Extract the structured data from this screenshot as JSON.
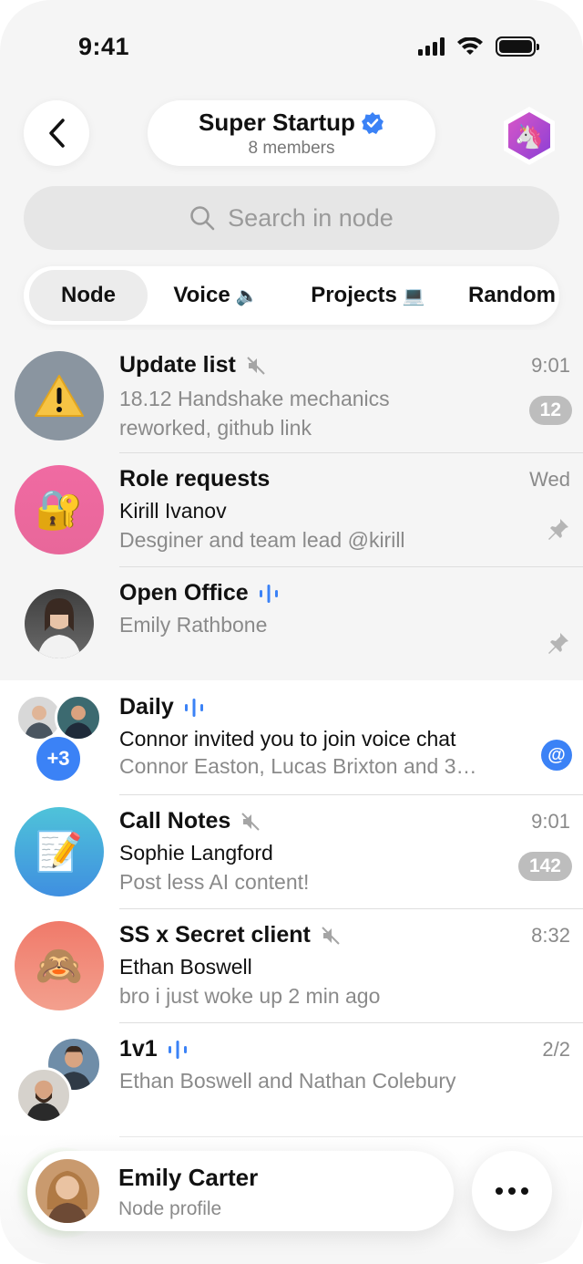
{
  "status_bar": {
    "time": "9:41"
  },
  "header": {
    "title": "Super Startup",
    "subtitle": "8 members",
    "verified_icon": "verified-badge-icon",
    "node_icon": "unicorn-hexagon-icon"
  },
  "search": {
    "placeholder": "Search in node"
  },
  "tabs": [
    {
      "label": "Node",
      "emoji": ""
    },
    {
      "label": "Voice",
      "emoji": "🔈"
    },
    {
      "label": "Projects",
      "emoji": "💻"
    },
    {
      "label": "Random",
      "emoji": ""
    }
  ],
  "chats": [
    {
      "name": "Update list",
      "line2": "18.12  Handshake mechanics",
      "line3": "reworked, github link",
      "time": "9:01",
      "badge": "12",
      "muted": true,
      "avatar_emoji": "⚠️",
      "avatar_color": "#8a95a0"
    },
    {
      "name": "Role requests",
      "line2": "Kirill Ivanov",
      "line3": "Desginer and team lead @kirill",
      "time": "Wed",
      "pinned": true,
      "avatar_emoji": "🔐",
      "avatar_color": "#e87aa6"
    },
    {
      "name": "Open Office",
      "line2": "Emily Rathbone",
      "pinned": true,
      "voice": true
    },
    {
      "name": "Daily",
      "line2": "Connor invited you to join voice chat",
      "line3": "Connor Easton, Lucas Brixton and 3…",
      "mention": "@",
      "voice": true,
      "extra_count": "+3"
    },
    {
      "name": "Call Notes",
      "line2": "Sophie Langford",
      "line3": "Post less AI content!",
      "time": "9:01",
      "badge": "142",
      "muted": true,
      "avatar_emoji": "📝",
      "avatar_color": "#4fb6d8"
    },
    {
      "name": "SS x Secret client",
      "line2": "Ethan Boswell",
      "line3": "bro i just woke up 2 min ago",
      "time": "8:32",
      "muted": true,
      "avatar_emoji": "🙈",
      "avatar_color": "#ef7b6b"
    },
    {
      "name": "1v1",
      "line2": "Ethan Boswell and Nathan Colebury",
      "time": "2/2",
      "voice": true
    }
  ],
  "profile": {
    "name": "Emily Carter",
    "subtitle": "Node profile"
  },
  "colors": {
    "accent": "#3b82f6",
    "badge_grey": "#bdbdbd"
  }
}
